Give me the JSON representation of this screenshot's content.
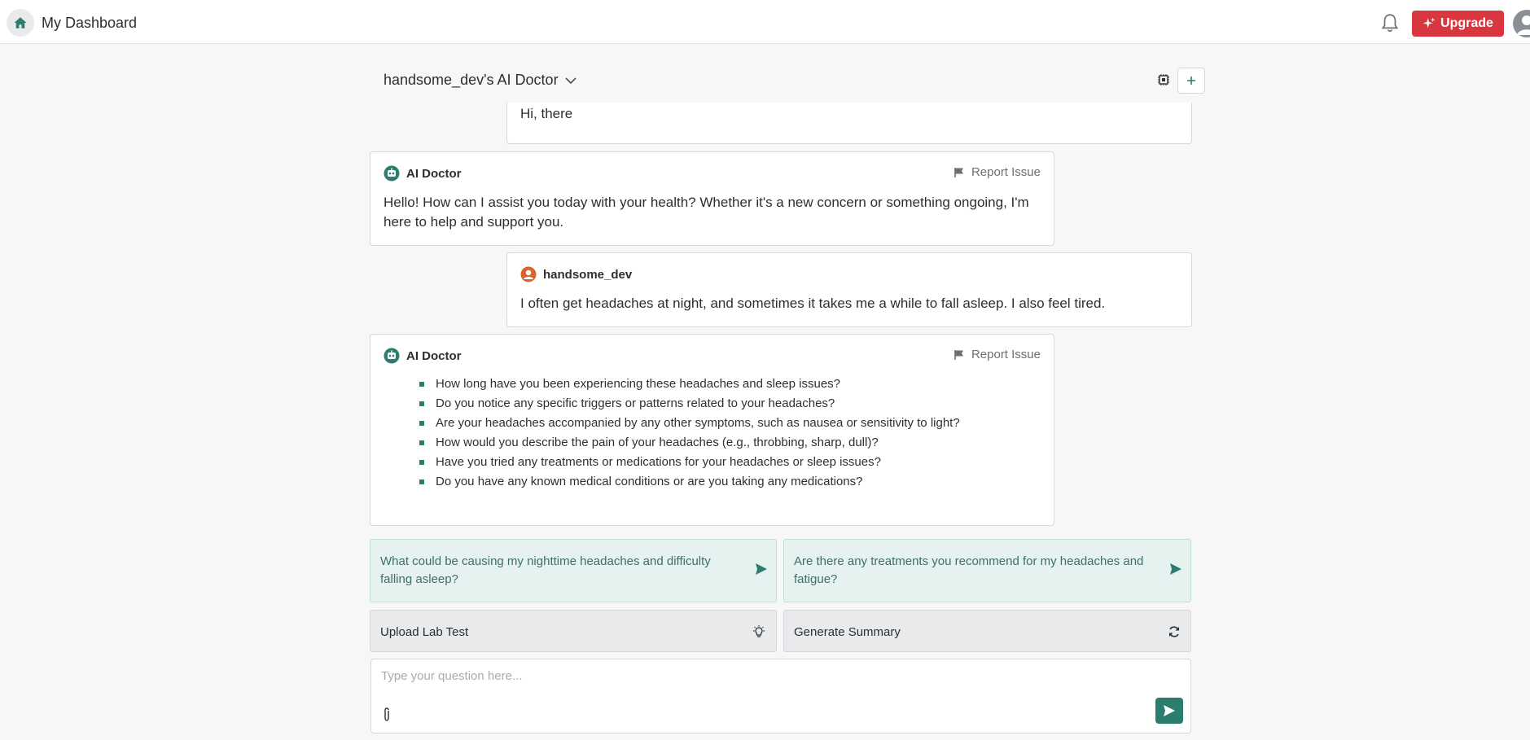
{
  "topbar": {
    "title": "My Dashboard",
    "upgrade_label": "Upgrade",
    "icons": [
      "home-icon",
      "bell-icon",
      "sparkle-icon",
      "user-avatar-icon"
    ]
  },
  "chat": {
    "title": "handsome_dev's AI Doctor",
    "icons": [
      "chevron-down-icon",
      "chip-icon",
      "plus-icon"
    ]
  },
  "messages": [
    {
      "role": "user",
      "text": "Hi, there"
    },
    {
      "role": "ai",
      "author": "AI Doctor",
      "report_label": "Report Issue",
      "text": "Hello! How can I assist you today with your health? Whether it's a new concern or something ongoing, I'm here to help and support you."
    },
    {
      "role": "user",
      "author": "handsome_dev",
      "text": "I often get headaches at night, and sometimes it takes me a while to fall asleep. I also feel tired."
    },
    {
      "role": "ai",
      "author": "AI Doctor",
      "report_label": "Report Issue",
      "bullets": [
        "How long have you been experiencing these headaches and sleep issues?",
        "Do you notice any specific triggers or patterns related to your headaches?",
        "Are your headaches accompanied by any other symptoms, such as nausea or sensitivity to light?",
        "How would you describe the pain of your headaches (e.g., throbbing, sharp, dull)?",
        "Have you tried any treatments or medications for your headaches or sleep issues?",
        "Do you have any known medical conditions or are you taking any medications?"
      ]
    }
  ],
  "suggestions": [
    "What could be causing my nighttime headaches and difficulty falling asleep?",
    "Are there any treatments you recommend for my headaches and fatigue?"
  ],
  "actions": {
    "upload_label": "Upload Lab Test",
    "summary_label": "Generate Summary"
  },
  "input": {
    "placeholder": "Type your question here...",
    "value": ""
  },
  "colors": {
    "accent": "#2a7d6f",
    "upgrade": "#d8373f",
    "suggest_bg": "#e5f2ef",
    "user_avatar": "#d9642c"
  }
}
